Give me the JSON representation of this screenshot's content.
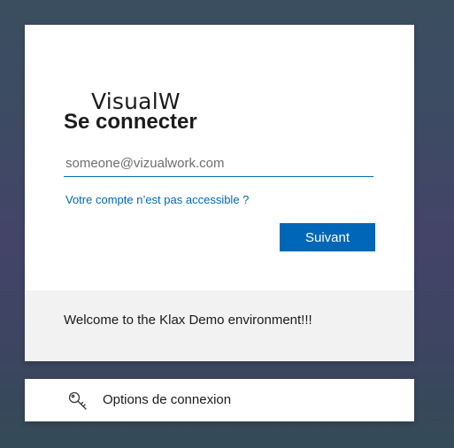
{
  "brand": {
    "logo_text": "VisualW"
  },
  "signin": {
    "title": "Se connecter",
    "email_placeholder": "someone@vizualwork.com",
    "email_value": "",
    "help_link": "Votre compte n’est pas accessible ?",
    "next_label": "Suivant"
  },
  "banner": {
    "text": "Welcome to the Klax Demo environment!!!"
  },
  "options": {
    "label": "Options de connexion",
    "icon": "key-icon"
  },
  "colors": {
    "accent": "#0067b8",
    "banner_bg": "#f2f2f2"
  }
}
